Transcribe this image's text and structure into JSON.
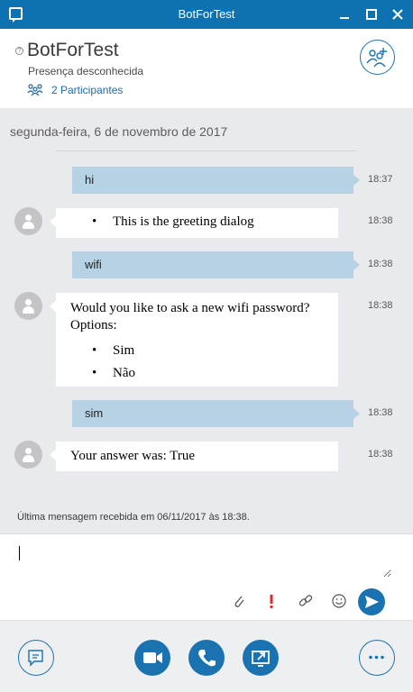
{
  "window": {
    "title": "BotForTest"
  },
  "header": {
    "contact_name": "BotForTest",
    "presence": "Presença desconhecida",
    "participants_label": "2 Participantes"
  },
  "conversation": {
    "date": "segunda-feira, 6 de novembro de 2017",
    "messages": [
      {
        "from": "me",
        "text": "hi",
        "time": "18:37"
      },
      {
        "from": "bot",
        "items": [
          "This is the greeting dialog"
        ],
        "time": "18:38"
      },
      {
        "from": "me",
        "text": "wifi",
        "time": "18:38"
      },
      {
        "from": "bot",
        "text": "Would you like to ask a new wifi password? Options:",
        "items": [
          "Sim",
          "Não"
        ],
        "time": "18:38"
      },
      {
        "from": "me",
        "text": "sim",
        "time": "18:38"
      },
      {
        "from": "bot",
        "text": "Your answer was: True",
        "time": "18:38"
      }
    ],
    "last_received": "Última mensagem recebida em 06/11/2017 às 18:38."
  },
  "compose": {
    "value": "",
    "placeholder": ""
  },
  "icons": {
    "app": "chat-bubble-icon",
    "minimize": "minimize-icon",
    "maximize": "maximize-icon",
    "close": "close-icon",
    "participants": "people-icon",
    "add_people": "add-people-icon",
    "attach": "paperclip-icon",
    "importance": "exclamation-icon",
    "link": "link-icon",
    "emoji": "smiley-icon",
    "send": "send-icon",
    "im": "im-icon",
    "video": "video-camera-icon",
    "call": "phone-icon",
    "share": "screen-share-icon",
    "more": "more-icon"
  },
  "colors": {
    "accent": "#1a73b0",
    "titlebar": "#0f72b0",
    "outgoing_bubble": "#b7d2e5",
    "conversation_bg": "#e9eaed"
  }
}
